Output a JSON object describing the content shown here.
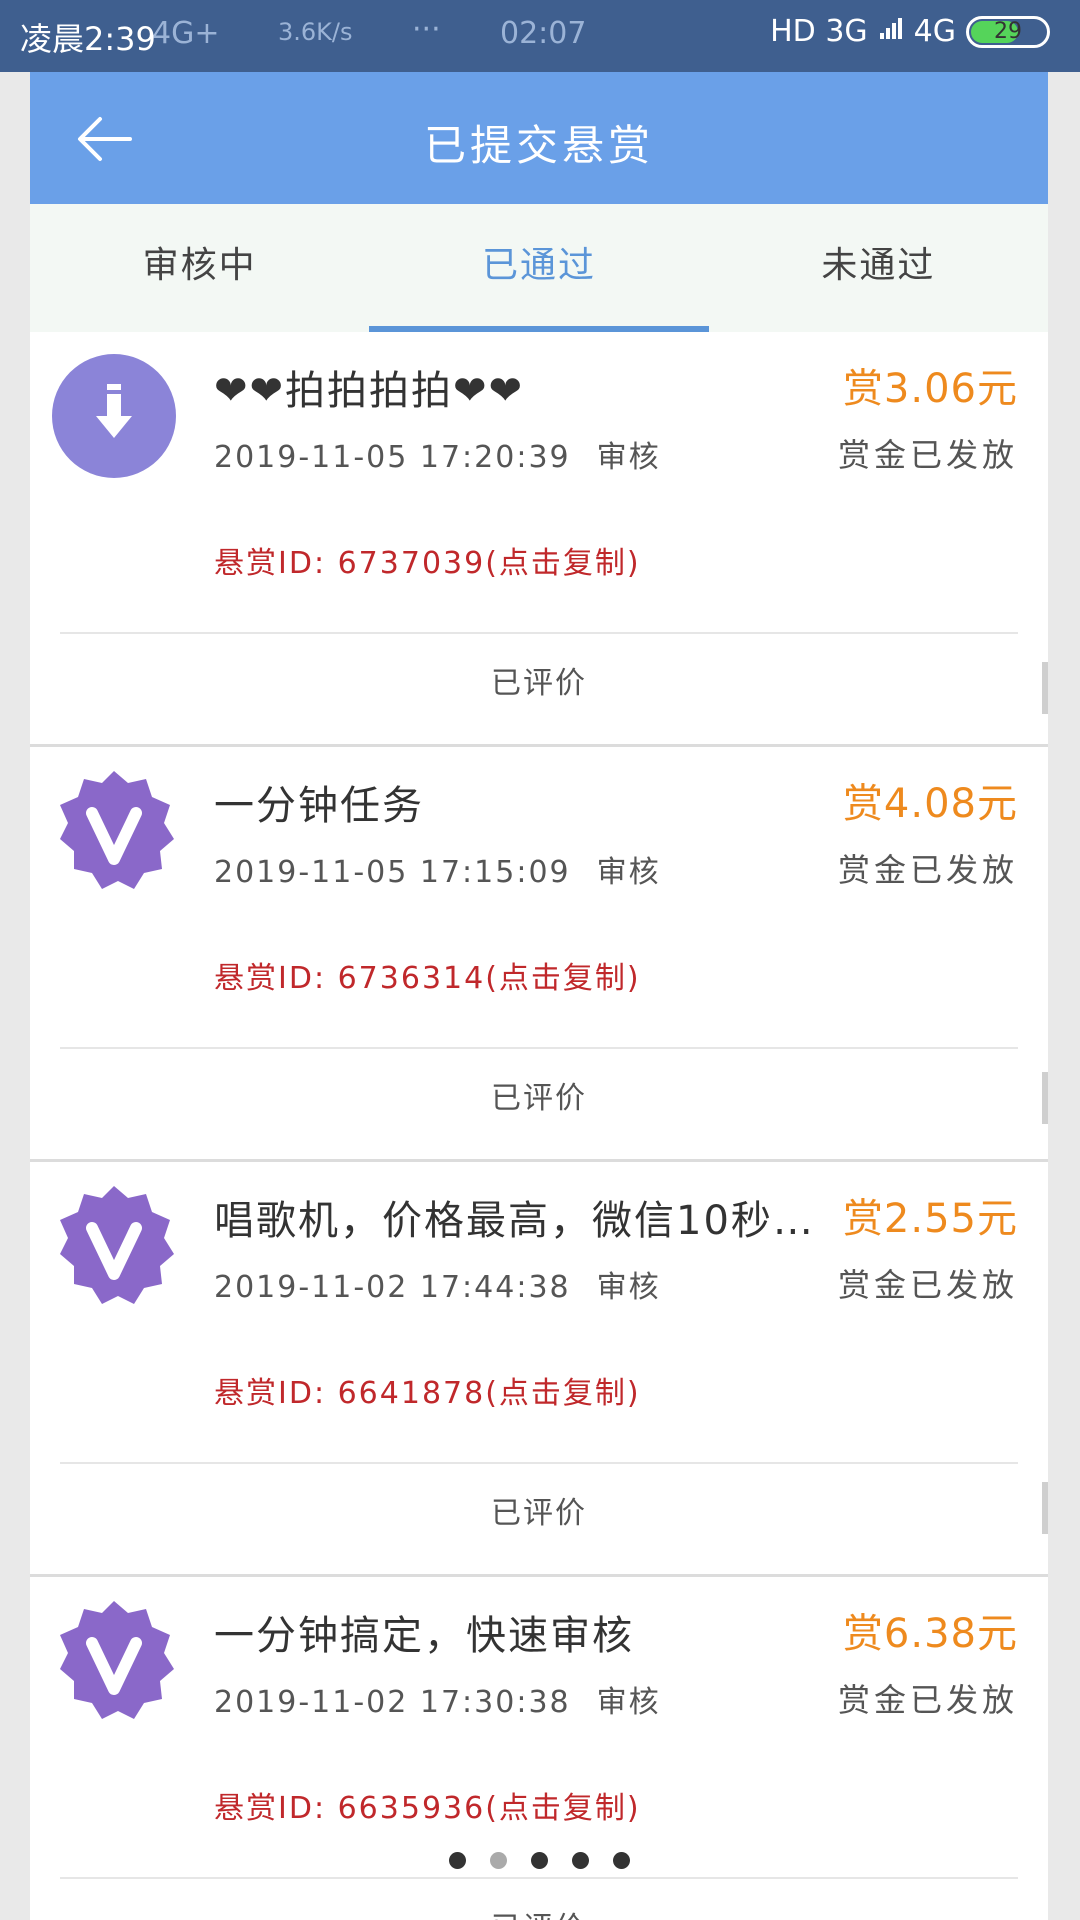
{
  "status_bar": {
    "time": "凌晨2:39",
    "network_left": "4G+",
    "speed": "3.6K/s",
    "dots": "···",
    "clock": "02:07",
    "right_signal": "HD 3G",
    "right_signal2": "4G",
    "battery": "29"
  },
  "header": {
    "title": "已提交悬赏"
  },
  "tabs": [
    {
      "label": "审核中",
      "active": false
    },
    {
      "label": "已通过",
      "active": true
    },
    {
      "label": "未通过",
      "active": false
    }
  ],
  "items": [
    {
      "avatar": "download-icon",
      "title": "❤❤拍拍拍拍❤❤",
      "reward": "赏3.06元",
      "datetime": "2019-11-05 17:20:39",
      "status_word": "审核",
      "payout_status": "赏金已发放",
      "bounty_id": "悬赏ID: 6737039(点击复制)",
      "action": "已评价"
    },
    {
      "avatar": "v-badge-icon",
      "title": "一分钟任务",
      "reward": "赏4.08元",
      "datetime": "2019-11-05 17:15:09",
      "status_word": "审核",
      "payout_status": "赏金已发放",
      "bounty_id": "悬赏ID: 6736314(点击复制)",
      "action": "已评价"
    },
    {
      "avatar": "v-badge-icon",
      "title": "唱歌机，价格最高，微信10秒…",
      "reward": "赏2.55元",
      "datetime": "2019-11-02 17:44:38",
      "status_word": "审核",
      "payout_status": "赏金已发放",
      "bounty_id": "悬赏ID: 6641878(点击复制)",
      "action": "已评价"
    },
    {
      "avatar": "v-badge-icon",
      "title": "一分钟搞定，快速审核",
      "reward": "赏6.38元",
      "datetime": "2019-11-02 17:30:38",
      "status_word": "审核",
      "payout_status": "赏金已发放",
      "bounty_id": "悬赏ID: 6635936(点击复制)",
      "action": "已评价"
    }
  ],
  "pager": {
    "count": 5,
    "active_index": 1
  },
  "colors": {
    "header": "#6aa0e8",
    "accent": "#5b95d8",
    "reward": "#ee8a1e",
    "id": "#c0282b",
    "avatar": "#8a68c9"
  }
}
